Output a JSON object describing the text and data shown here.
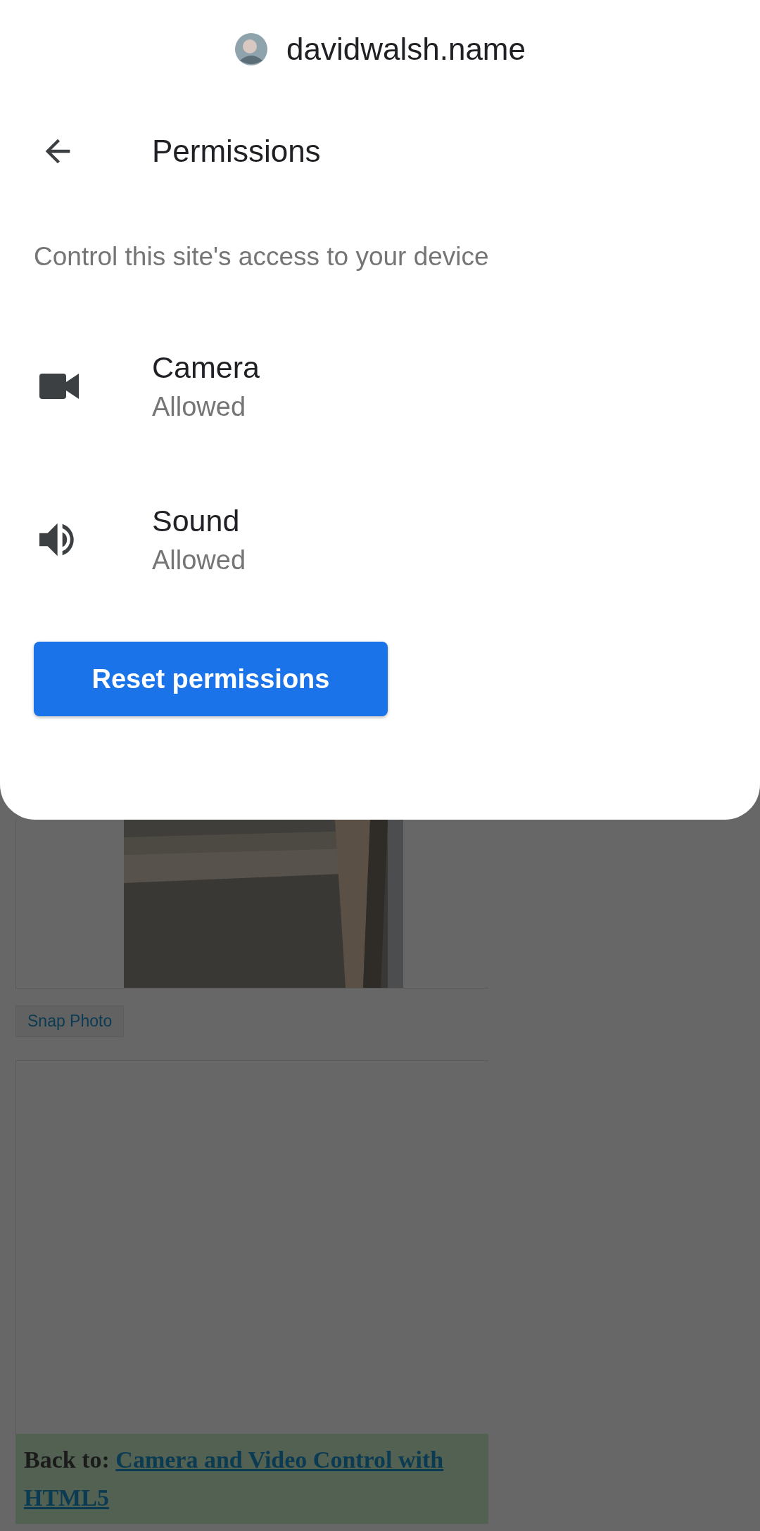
{
  "site": {
    "name": "davidwalsh.name"
  },
  "header": {
    "title": "Permissions"
  },
  "description": "Control this site's access to your device",
  "permissions": [
    {
      "kind": "camera",
      "name": "Camera",
      "status": "Allowed"
    },
    {
      "kind": "sound",
      "name": "Sound",
      "status": "Allowed"
    }
  ],
  "reset_button": "Reset permissions",
  "page": {
    "snap_button": "Snap Photo",
    "back_label": "Back to:",
    "back_link": "Camera and Video Control with HTML5"
  }
}
